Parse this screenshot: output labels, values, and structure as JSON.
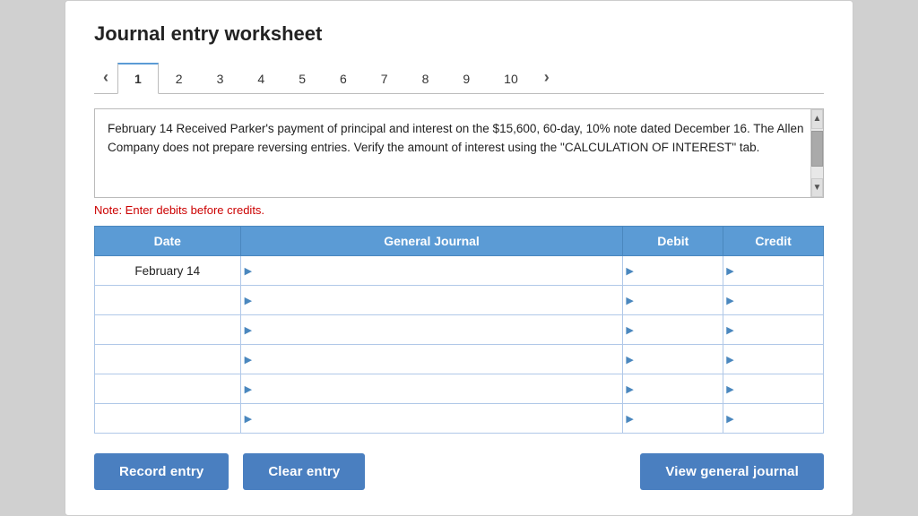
{
  "page": {
    "title": "Journal entry worksheet",
    "note": "Note: Enter debits before credits."
  },
  "tabs": {
    "prev_arrow": "‹",
    "next_arrow": "›",
    "items": [
      {
        "label": "1",
        "active": true
      },
      {
        "label": "2",
        "active": false
      },
      {
        "label": "3",
        "active": false
      },
      {
        "label": "4",
        "active": false
      },
      {
        "label": "5",
        "active": false
      },
      {
        "label": "6",
        "active": false
      },
      {
        "label": "7",
        "active": false
      },
      {
        "label": "8",
        "active": false
      },
      {
        "label": "9",
        "active": false
      },
      {
        "label": "10",
        "active": false
      }
    ]
  },
  "description": "February 14 Received Parker's payment of principal and interest on the $15,600, 60-day, 10% note dated December 16. The Allen Company does not prepare reversing entries. Verify the amount of interest using the \"CALCULATION OF INTEREST\" tab.",
  "table": {
    "headers": [
      "Date",
      "General Journal",
      "Debit",
      "Credit"
    ],
    "rows": [
      {
        "date": "February 14",
        "journal": "",
        "debit": "",
        "credit": ""
      },
      {
        "date": "",
        "journal": "",
        "debit": "",
        "credit": ""
      },
      {
        "date": "",
        "journal": "",
        "debit": "",
        "credit": ""
      },
      {
        "date": "",
        "journal": "",
        "debit": "",
        "credit": ""
      },
      {
        "date": "",
        "journal": "",
        "debit": "",
        "credit": ""
      },
      {
        "date": "",
        "journal": "",
        "debit": "",
        "credit": ""
      }
    ]
  },
  "buttons": {
    "record": "Record entry",
    "clear": "Clear entry",
    "view": "View general journal"
  }
}
